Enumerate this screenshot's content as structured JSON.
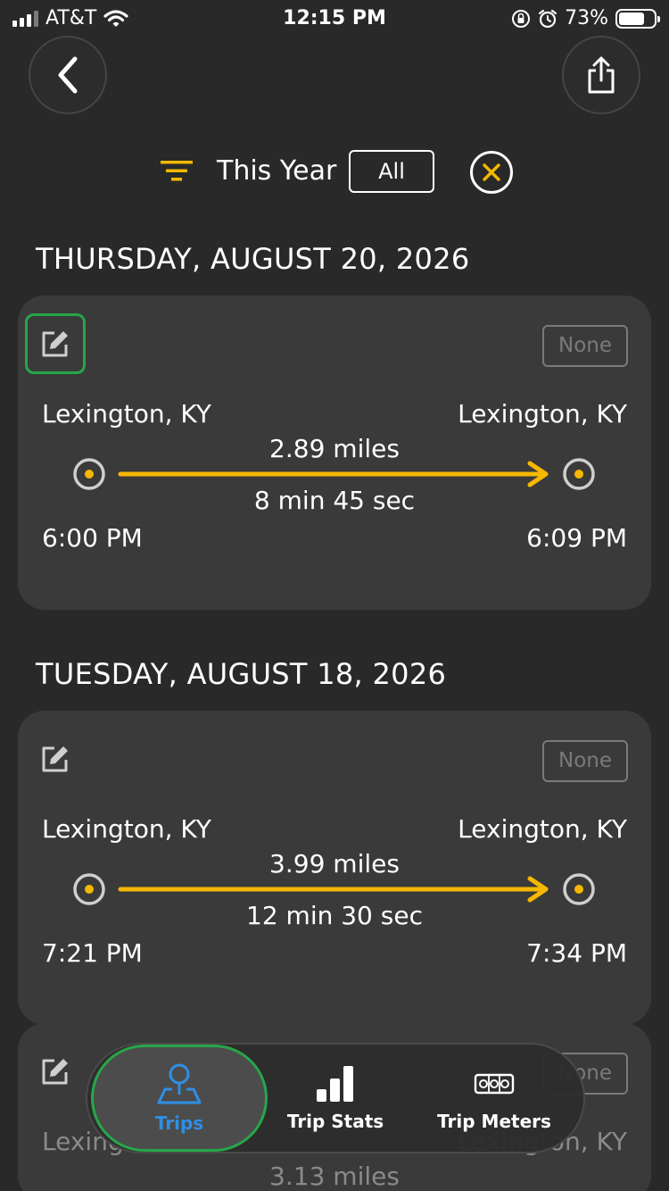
{
  "status_bar": {
    "carrier": "AT&T",
    "time": "12:15 PM",
    "battery_percent": "73%"
  },
  "header": {
    "back_icon": "chevron-left-icon",
    "share_icon": "share-icon"
  },
  "filter": {
    "icon": "filter-icon",
    "period_label": "This Year",
    "category_chip": "All",
    "clear_icon": "close-circle-icon"
  },
  "colors": {
    "background": "#292929",
    "card": "#3a3a3a",
    "accent": "#f5b800",
    "highlight": "#27a64a",
    "active_tab": "#2e8fe5"
  },
  "trip_groups": [
    {
      "date": "THURSDAY, AUGUST 20, 2026",
      "trip": {
        "tag": "None",
        "from_city": "Lexington, KY",
        "to_city": "Lexington, KY",
        "distance": "2.89 miles",
        "duration": "8 min 45 sec",
        "start_time": "6:00 PM",
        "end_time": "6:09 PM"
      }
    },
    {
      "date": "TUESDAY, AUGUST 18, 2026",
      "trip": {
        "tag": "None",
        "from_city": "Lexington, KY",
        "to_city": "Lexington, KY",
        "distance": "3.99 miles",
        "duration": "12 min 30 sec",
        "start_time": "7:21 PM",
        "end_time": "7:34 PM"
      }
    },
    {
      "trip": {
        "tag": "None",
        "from_city": "Lexington, KY",
        "to_city": "Lexington, KY",
        "distance": "3.13 miles"
      }
    }
  ],
  "tab_bar": {
    "tabs": [
      {
        "label": "Trips",
        "icon": "map-pin-icon",
        "active": true
      },
      {
        "label": "Trip Stats",
        "icon": "bar-chart-icon",
        "active": false
      },
      {
        "label": "Trip Meters",
        "icon": "odometer-icon",
        "active": false
      }
    ]
  }
}
